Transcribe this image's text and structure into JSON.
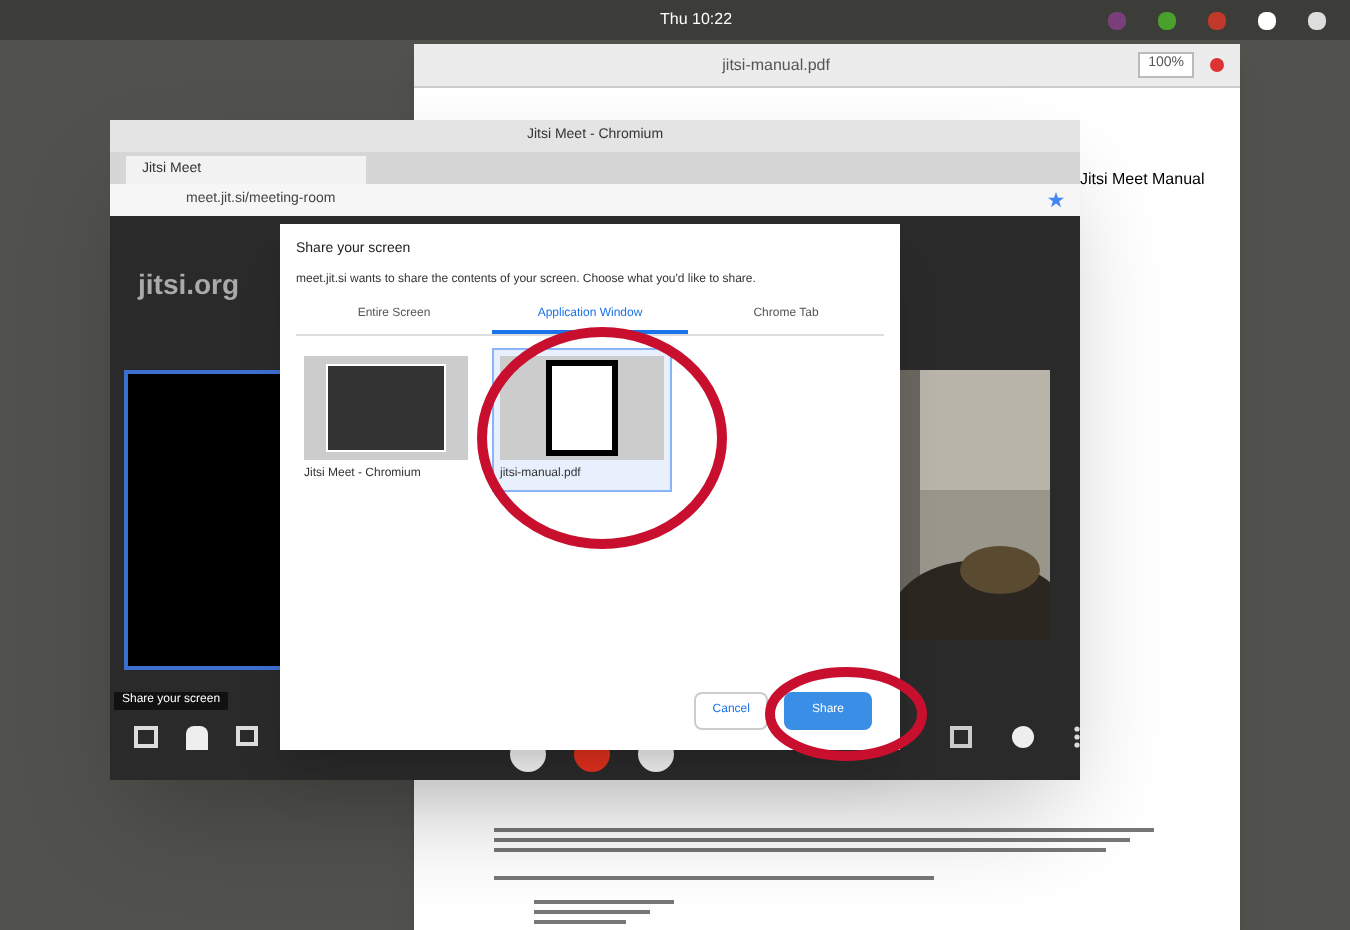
{
  "top_bar": {
    "clock": "Thu 10:22"
  },
  "pdf_window": {
    "title": "jitsi-manual.pdf",
    "zoom": "100%",
    "side_text": "Jitsi Meet Manual"
  },
  "browser": {
    "title": "Jitsi Meet - Chromium",
    "tab": "Jitsi Meet",
    "url": "meet.jit.si/meeting-room"
  },
  "jitsi": {
    "logo": "jitsi.org",
    "tooltip": "Share your screen"
  },
  "dialog": {
    "title": "Share your screen",
    "subtitle": "meet.jit.si wants to share the contents of your screen. Choose what you'd like to share.",
    "tabs": [
      {
        "label": "Entire Screen",
        "selected": false
      },
      {
        "label": "Application Window",
        "selected": true
      },
      {
        "label": "Chrome Tab",
        "selected": false
      }
    ],
    "sources": [
      {
        "label": "Jitsi Meet - Chromium",
        "selected": false
      },
      {
        "label": "jitsi-manual.pdf",
        "selected": true
      }
    ],
    "buttons": [
      {
        "label": "Cancel",
        "kind": "secondary"
      },
      {
        "label": "Share",
        "kind": "primary"
      }
    ]
  }
}
